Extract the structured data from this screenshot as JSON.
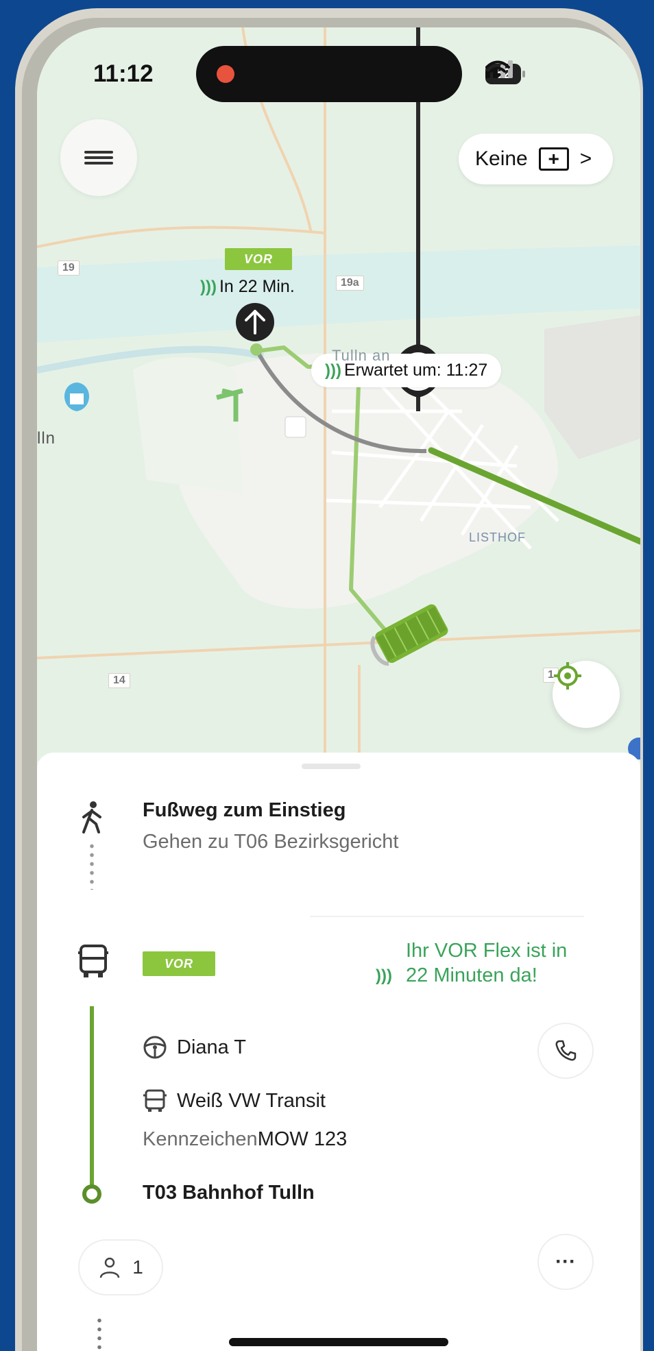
{
  "status_bar": {
    "time": "11:12",
    "battery": "52"
  },
  "map": {
    "keine_label": "Keine",
    "keine_plus": "+",
    "keine_chevron": ">",
    "vor_logo": "VOR",
    "pickup_eta": "In 22 Min.",
    "expected_label": "Erwartet um: 11:27",
    "district_label": "LISTHOF",
    "partial_label_left": "lln",
    "partial_label_town": "Tulln an",
    "road_19": "19",
    "road_19a": "19a",
    "road_14": "14",
    "road_1": "1"
  },
  "sheet": {
    "walk": {
      "title": "Fußweg zum Einstieg",
      "subtitle": "Gehen zu T06 Bezirksgericht"
    },
    "ride": {
      "logo": "VOR",
      "arrival_line1": "Ihr VOR Flex ist in",
      "arrival_line2": "22 Minuten da!",
      "driver": "Diana T",
      "vehicle": "Weiß VW Transit",
      "plate_label": "Kennzeichen",
      "plate_value": "MOW 123",
      "destination": "T03 Bahnhof Tulln"
    },
    "passengers": "1",
    "more": "···"
  },
  "colors": {
    "accent_green": "#3aa35a",
    "route_green": "#6aa531",
    "vor_green": "#8cc63f",
    "frame_blue": "#0d4790"
  }
}
